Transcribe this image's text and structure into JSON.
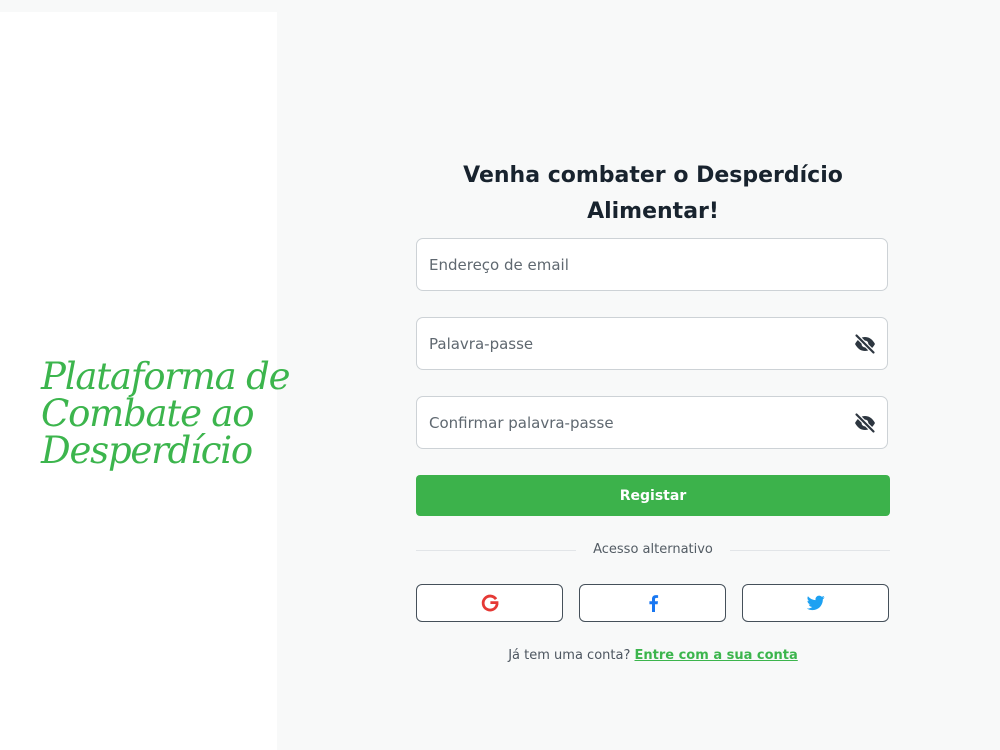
{
  "brand": {
    "lines": [
      "Plataforma de",
      "Combate ao",
      "Desperdício"
    ],
    "color": "#3cb54d"
  },
  "form": {
    "heading": "Venha combater o Desperdício Alimentar!",
    "email_placeholder": "Endereço de email",
    "password_placeholder": "Palavra-passe",
    "confirm_placeholder": "Confirmar palavra-passe",
    "password_toggle_icon": "eye-slash-icon",
    "submit_label": "Registar",
    "submit_color": "#3cb24b"
  },
  "alt_access": {
    "label": "Acesso alternativo",
    "providers": [
      {
        "name": "google",
        "icon": "google-icon",
        "color": "#e53935"
      },
      {
        "name": "facebook",
        "icon": "facebook-icon",
        "color": "#1877f2"
      },
      {
        "name": "twitter",
        "icon": "twitter-icon",
        "color": "#1da1f2"
      }
    ]
  },
  "footer": {
    "prompt": "Já tem uma conta?",
    "link_label": "Entre com a sua conta"
  }
}
